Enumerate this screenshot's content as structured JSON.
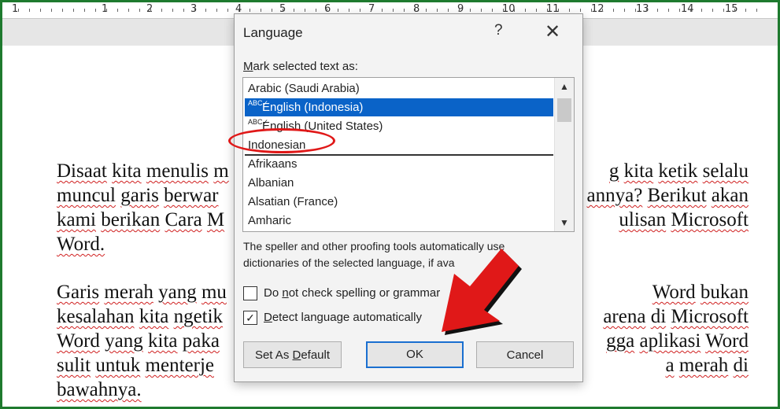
{
  "ruler": {
    "numbers": [
      "1",
      "1",
      "2",
      "3",
      "4",
      "5",
      "6",
      "7",
      "8",
      "9",
      "10",
      "11",
      "12",
      "13",
      "14",
      "15"
    ]
  },
  "document": {
    "lines": [
      [
        "Disaat",
        "kita",
        "menulis",
        "m"
      ],
      [
        "muncul",
        "garis",
        "berwar"
      ],
      [
        "kami",
        "berikan",
        "Cara",
        "M"
      ],
      [
        "Word."
      ],
      [],
      [
        "Garis",
        "merah",
        "yang",
        "mu"
      ],
      [
        "kesalahan",
        "kita",
        "ngetik"
      ],
      [
        "Word",
        "yang",
        "kita",
        "paka"
      ],
      [
        "sulit",
        "untuk",
        "menterje"
      ],
      [
        "bawahnya."
      ]
    ],
    "right_lines": [
      "g kita ketik selalu",
      "annya? Berikut akan",
      "ulisan Microsoft",
      "",
      "",
      "Word bukan",
      "arena di Microsoft",
      "gga aplikasi Word",
      "a merah di",
      ""
    ]
  },
  "dialog": {
    "title": "Language",
    "help_label": "?",
    "close_label": "✕",
    "mark_label_hot": "M",
    "mark_label_rest": "ark selected text as:",
    "languages_top": [
      "Arabic (Saudi Arabia)",
      "English (Indonesia)",
      "English (United States)",
      "Indonesian"
    ],
    "languages_bottom": [
      "Afrikaans",
      "Albanian",
      "Alsatian (France)",
      "Amharic"
    ],
    "selected_index": 1,
    "abc_marker": "ABC✓",
    "description": "The speller and other proofing tools automatically use dictionaries of the selected language, if ava",
    "checkbox1_pre": "Do ",
    "checkbox1_hot": "n",
    "checkbox1_rest": "ot check spelling or grammar",
    "checkbox1_checked": false,
    "checkbox2_pre": "",
    "checkbox2_hot": "D",
    "checkbox2_rest": "etect language automatically",
    "checkbox2_checked": true,
    "checkmark": "✓",
    "set_default_pre": "Set As ",
    "set_default_hot": "D",
    "set_default_rest": "efault",
    "ok_label": "OK",
    "cancel_label": "Cancel"
  },
  "colors": {
    "frame": "#1e7a2e",
    "selection": "#0a63c8",
    "annotation": "#e01818"
  },
  "icons": {
    "scroll_up": "chevron-up-icon",
    "scroll_down": "chevron-down-icon"
  }
}
